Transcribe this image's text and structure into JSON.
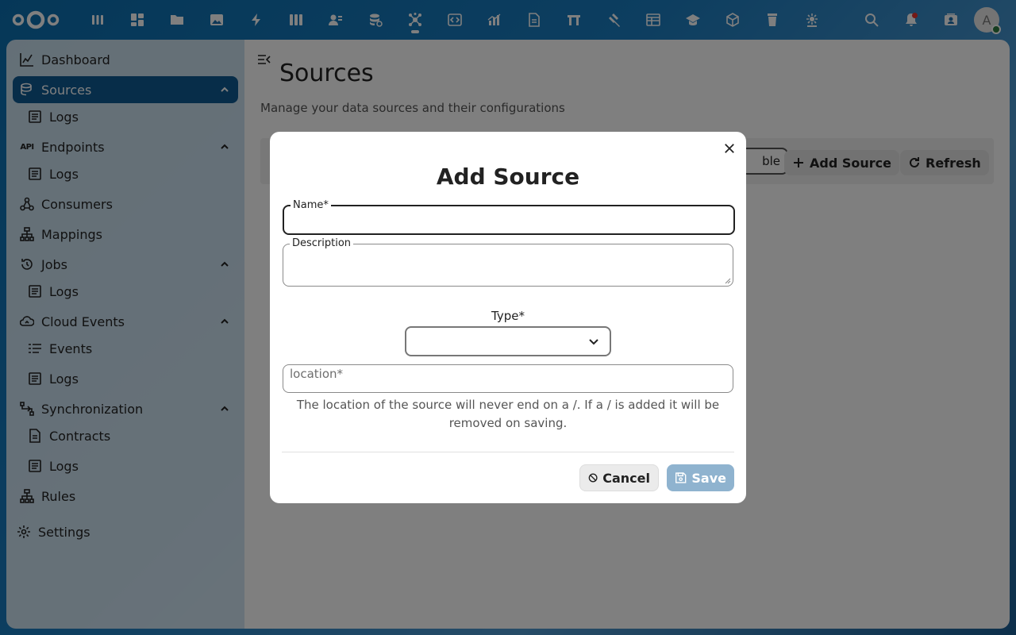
{
  "header": {
    "app_icons": [
      "dashboard-apps-icon",
      "grid-icon",
      "files-icon",
      "photos-icon",
      "activity-icon",
      "deck-icon",
      "contacts-icon",
      "database-icon",
      "connections-icon",
      "code-icon",
      "analytics-icon",
      "document-icon",
      "flag-icon",
      "gavel-icon",
      "calendar-table-icon",
      "education-icon",
      "package-icon",
      "trash-icon",
      "settings-network-icon"
    ],
    "active_app_index": 8,
    "avatar_initial": "A"
  },
  "sidebar": {
    "items": [
      {
        "label": "Dashboard",
        "icon": "chart-icon"
      },
      {
        "label": "Sources",
        "icon": "database-icon",
        "active": true
      },
      {
        "label": "Logs",
        "icon": "log-icon",
        "sub": true
      },
      {
        "label": "Endpoints",
        "icon": "api-icon",
        "api_text": "API"
      },
      {
        "label": "Logs",
        "icon": "log-icon",
        "sub": true
      },
      {
        "label": "Consumers",
        "icon": "webhook-icon"
      },
      {
        "label": "Mappings",
        "icon": "sitemap-icon"
      },
      {
        "label": "Jobs",
        "icon": "history-icon"
      },
      {
        "label": "Logs",
        "icon": "log-icon",
        "sub": true
      },
      {
        "label": "Cloud Events",
        "icon": "cloud-sync-icon"
      },
      {
        "label": "Events",
        "icon": "events-icon",
        "sub": true
      },
      {
        "label": "Logs",
        "icon": "log-icon",
        "sub": true
      },
      {
        "label": "Synchronization",
        "icon": "sync-icon"
      },
      {
        "label": "Contracts",
        "icon": "contract-icon",
        "sub": true
      },
      {
        "label": "Logs",
        "icon": "log-icon",
        "sub": true
      },
      {
        "label": "Rules",
        "icon": "rules-icon"
      },
      {
        "label": "Settings",
        "icon": "gear-icon"
      }
    ]
  },
  "main": {
    "title": "Sources",
    "subtitle": "Manage your data sources and their configurations",
    "table_chip_partial": "ble",
    "add_source_label": "Add Source",
    "refresh_label": "Refresh"
  },
  "modal": {
    "title": "Add Source",
    "name_label": "Name*",
    "name_value": "",
    "description_label": "Description",
    "description_value": "",
    "type_label": "Type*",
    "type_value": "",
    "location_placeholder": "location*",
    "helper_text": "The location of the source will never end on a /. If a / is added it will be removed on saving.",
    "cancel_label": "Cancel",
    "save_label": "Save"
  },
  "colors": {
    "primary": "#0e5a93",
    "save_disabled": "#8fb3cf"
  }
}
